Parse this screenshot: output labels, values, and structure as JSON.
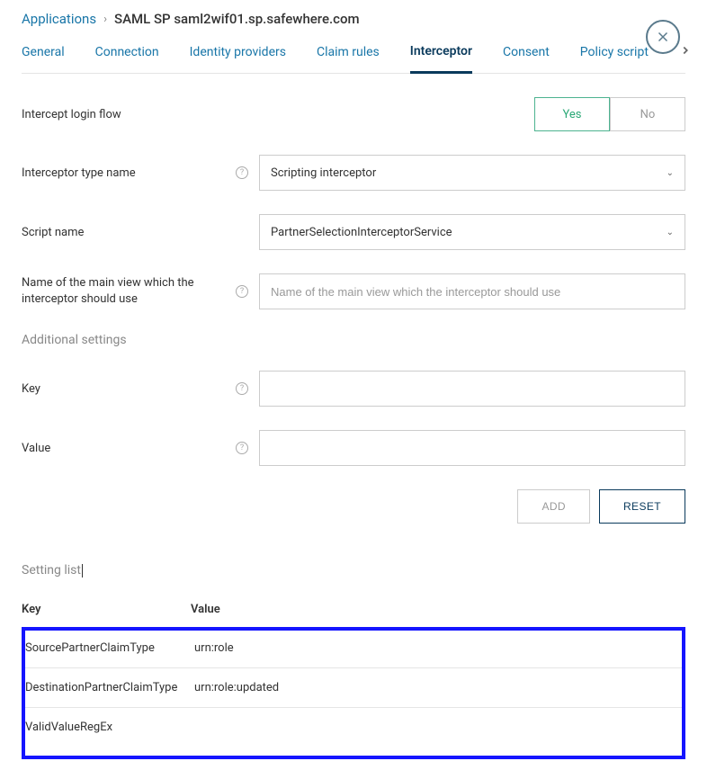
{
  "breadcrumb": {
    "root": "Applications",
    "title": "SAML SP saml2wif01.sp.safewhere.com"
  },
  "tabs": [
    {
      "label": "General"
    },
    {
      "label": "Connection"
    },
    {
      "label": "Identity providers"
    },
    {
      "label": "Claim rules"
    },
    {
      "label": "Interceptor",
      "active": true
    },
    {
      "label": "Consent"
    },
    {
      "label": "Policy script"
    }
  ],
  "form": {
    "intercept_label": "Intercept login flow",
    "yes": "Yes",
    "no": "No",
    "type_label": "Interceptor type name",
    "type_value": "Scripting interceptor",
    "script_label": "Script name",
    "script_value": "PartnerSelectionInterceptorService",
    "mainview_label": "Name of the main view which the interceptor should use",
    "mainview_placeholder": "Name of the main view which the interceptor should use"
  },
  "additional": {
    "heading": "Additional settings",
    "key_label": "Key",
    "value_label": "Value",
    "add_btn": "ADD",
    "reset_btn": "RESET"
  },
  "setting_list": {
    "heading": "Setting list",
    "col_key": "Key",
    "col_value": "Value",
    "rows": [
      {
        "key": "SourcePartnerClaimType",
        "value": "urn:role"
      },
      {
        "key": "DestinationPartnerClaimType",
        "value": "urn:role:updated"
      },
      {
        "key": "ValidValueRegEx",
        "value": ""
      }
    ]
  }
}
